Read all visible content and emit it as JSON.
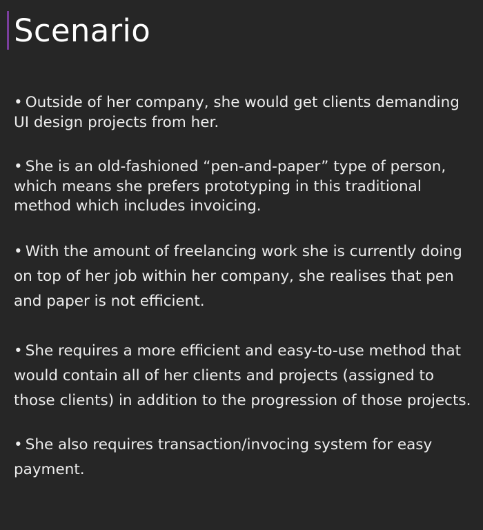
{
  "slide": {
    "title": "Scenario",
    "bullet_symbol": "•",
    "accent_color": "#7a3e9d",
    "background_color": "#262626",
    "bullets": [
      "Outside of her company, she would get clients demanding UI design projects from her.",
      "She is an old-fashioned “pen-and-paper” type of person, which means she prefers prototyping in this traditional method which includes invoicing.",
      "With the amount of freelancing work she is currently doing on top of her job within her company, she realises that pen and paper is not efficient.",
      "She requires a more efficient and easy-to-use method that would contain all of her clients and projects (assigned to those clients) in addition to the progression of those projects.",
      "She also requires transaction/invocing system for easy payment."
    ]
  }
}
